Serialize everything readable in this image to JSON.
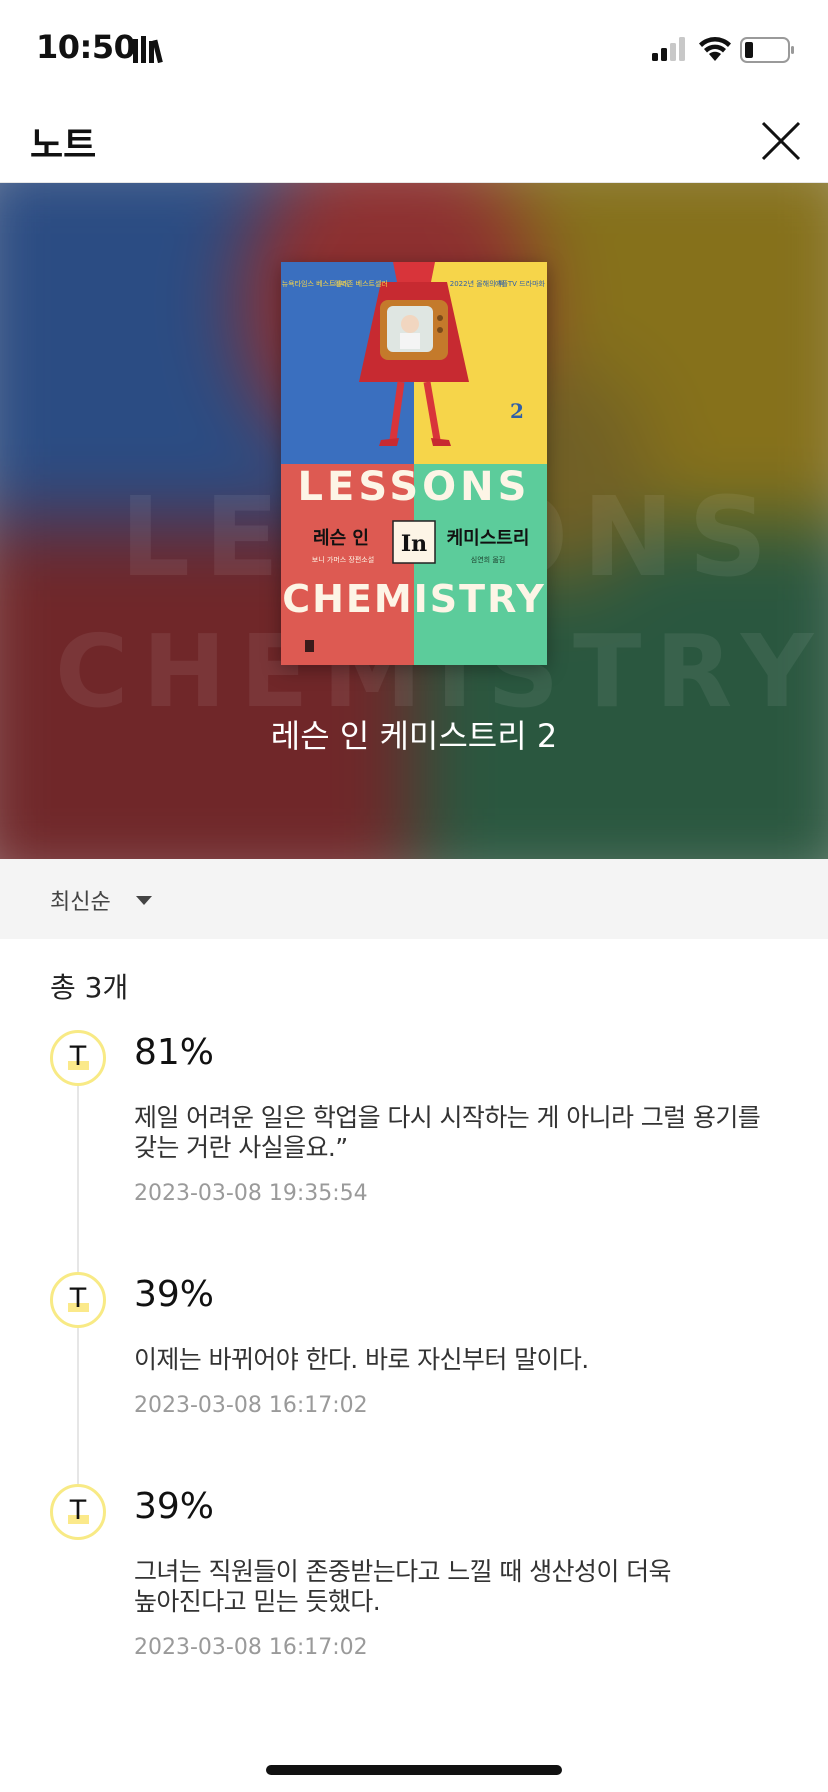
{
  "status_bar": {
    "time": "10:50",
    "icons": [
      "library-icon",
      "cellular-signal-icon",
      "wifi-icon",
      "battery-icon"
    ]
  },
  "header": {
    "title": "노트",
    "close_icon": "close-icon"
  },
  "book": {
    "title": "레슨 인 케미스트리 2",
    "cover": {
      "badges": [
        "뉴욕타임스 베스트셀러",
        "아마존 베스트셀러",
        "2022년 올해의 책",
        "애플TV 드라마화"
      ],
      "volume": "2",
      "title_en_1": "LESSONS",
      "title_en_in": "In",
      "title_en_2": "CHEMISTRY",
      "title_ko_left": "레슨 인",
      "title_ko_right": "케미스트리",
      "author": "보니 가머스 장편소설",
      "translator": "심연희 옮김"
    },
    "colors": {
      "blue": "#3a6fbf",
      "yellow": "#f6d54a",
      "red": "#dd5a52",
      "green": "#5ccc9b"
    }
  },
  "sort": {
    "label": "최신순",
    "icon": "caret-down-icon"
  },
  "list": {
    "total": "총 3개",
    "notes": [
      {
        "percent": "81%",
        "line1": "제일 어려운 일은 학업을 다시 시작하는 게 아니라 그럴 용기를",
        "line2": "갖는 거란 사실을요.”",
        "date": "2023-03-08 19:35:54",
        "icon_letter": "T"
      },
      {
        "percent": "39%",
        "line1": "이제는 바뀌어야 한다. 바로 자신부터 말이다.",
        "line2": "",
        "date": "2023-03-08 16:17:02",
        "icon_letter": "T"
      },
      {
        "percent": "39%",
        "line1": "그녀는 직원들이 존중받는다고 느낄 때 생산성이 더욱",
        "line2": "높아진다고 믿는 듯했다.",
        "date": "2023-03-08 16:17:02",
        "icon_letter": "T"
      }
    ]
  }
}
